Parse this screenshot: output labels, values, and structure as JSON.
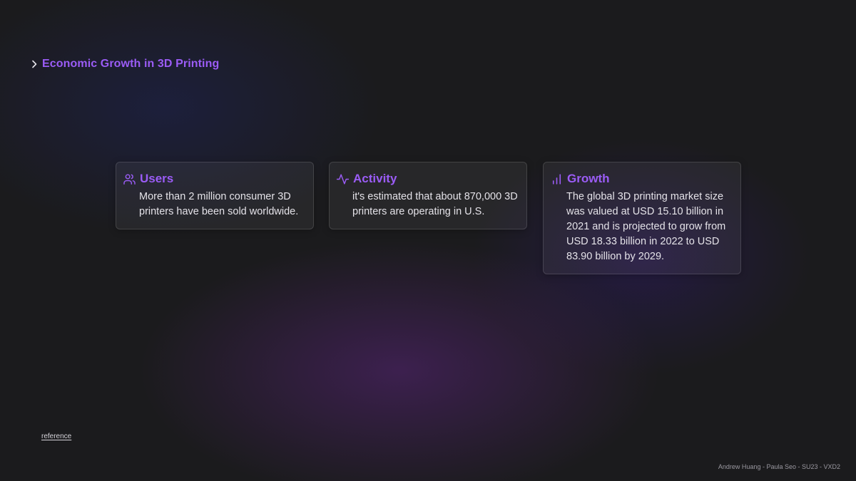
{
  "header": {
    "title": "Economic Growth in 3D Printing",
    "chevron_icon": "chevron-right-icon"
  },
  "cards": [
    {
      "icon": "users-icon",
      "title": "Users",
      "body": "More than 2 million consumer 3D printers have been sold worldwide."
    },
    {
      "icon": "activity-icon",
      "title": "Activity",
      "body": "it's estimated that about 870,000 3D printers are operating in U.S."
    },
    {
      "icon": "bar-chart-icon",
      "title": "Growth",
      "body": "The global 3D printing market size was valued at USD 15.10 billion in 2021 and is projected to grow from USD 18.33 billion in 2022 to USD 83.90 billion by 2029."
    }
  ],
  "footer": {
    "reference_label": "reference",
    "credits": "Andrew Huang - Paula Seo - SU23 - VXD2"
  },
  "colors": {
    "accent": "#9b5cf6",
    "background": "#1b1b1d"
  }
}
